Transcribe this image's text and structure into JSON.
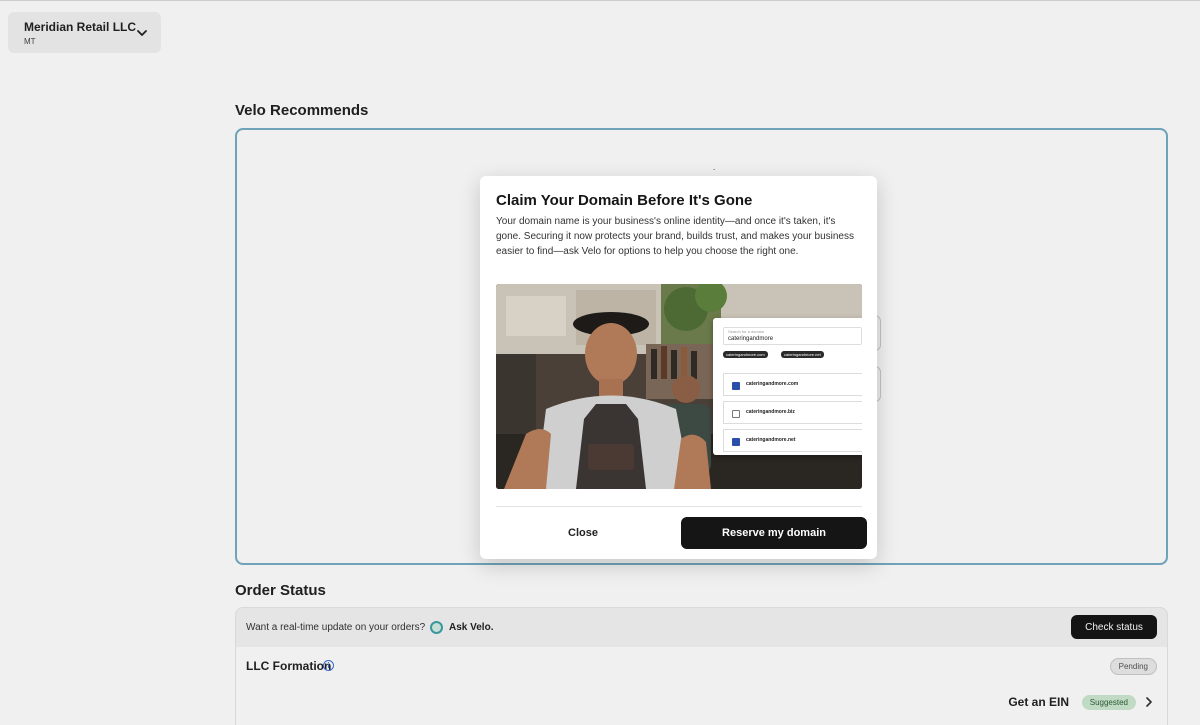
{
  "business": {
    "name": "Meridian Retail LLC",
    "state": "MT"
  },
  "recommendations": {
    "title": "Velo Recommends"
  },
  "modal": {
    "title": "Claim Your Domain Before It's Gone",
    "body": "Your domain name is your business's online identity—and once it's taken, it's gone. Securing it now protects your brand, builds trust, and makes your business easier to find—ask Velo for options to help you choose the right one.",
    "image": {
      "search_label": "Search for a domain",
      "search_value": "cateringandmore",
      "chips": [
        "cateringandmore.com",
        "cateringandmore.net"
      ],
      "domains": [
        {
          "name": "cateringandmore.com",
          "checked": true
        },
        {
          "name": "cateringandmore.biz",
          "checked": false
        },
        {
          "name": "cateringandmore.net",
          "checked": true
        }
      ]
    },
    "close_label": "Close",
    "reserve_label": "Reserve my domain"
  },
  "order_status": {
    "title": "Order Status",
    "prompt": "Want a real-time update on your orders?",
    "ask_label": "Ask Velo.",
    "check_label": "Check status",
    "items": [
      {
        "label": "LLC Formation",
        "badge": "Pending"
      },
      {
        "label": "Get an EIN",
        "badge": "Suggested"
      }
    ]
  },
  "colors": {
    "primary_button": "#151515",
    "card_outline": "#5c86d8",
    "suggested_badge": "#cde8d1",
    "pending_badge": "#ebebeb"
  }
}
